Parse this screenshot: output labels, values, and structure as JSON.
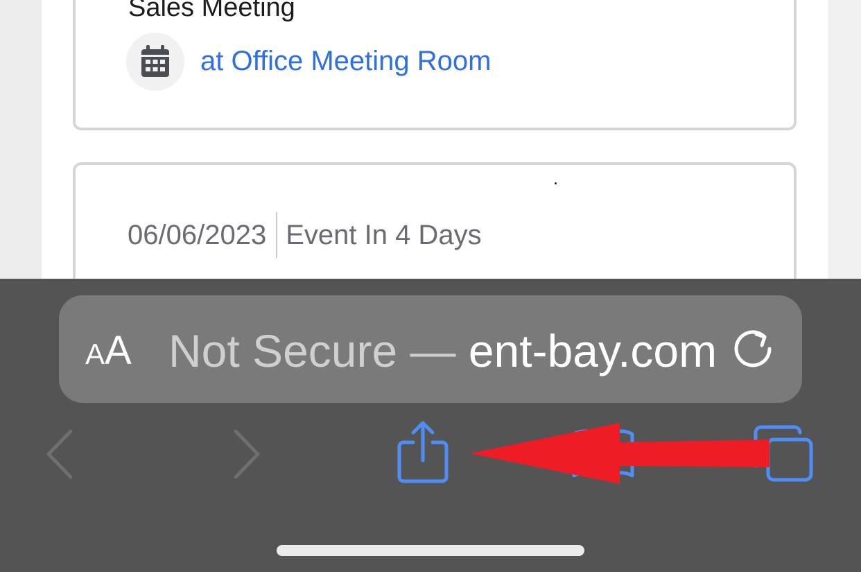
{
  "event": {
    "title": "Sales Meeting",
    "location": "at Office Meeting Room",
    "calendar_icon": "calendar-icon"
  },
  "next_event": {
    "date": "06/06/2023",
    "countdown": "Event In 4 Days"
  },
  "browser": {
    "text_size_button": {
      "small": "A",
      "big": "A"
    },
    "url_prefix": "Not Secure — ",
    "url_domain": "ent-bay.com",
    "icons": {
      "reload": "reload-icon",
      "back": "chevron-left-icon",
      "forward": "chevron-right-icon",
      "share": "share-icon",
      "bookmarks": "book-icon",
      "tabs": "tabs-icon"
    }
  },
  "annotation": {
    "color": "#ee1c25"
  },
  "colors": {
    "link": "#2f6fe0",
    "toolbar": "#545454",
    "url_bar": "#7a7a7a",
    "share_icon": "#4f8ef5"
  }
}
